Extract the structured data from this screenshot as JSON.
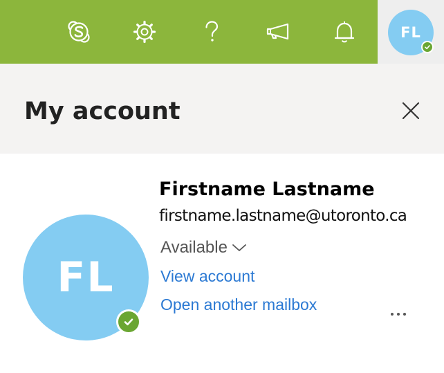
{
  "colors": {
    "topbar_green": "#8cb63c",
    "avatar_blue": "#84ccf2",
    "presence_green": "#6aa632",
    "link_blue": "#2b79d3"
  },
  "topbar": {
    "icons": [
      "skype-icon",
      "gear-icon",
      "help-icon",
      "megaphone-icon",
      "bell-icon"
    ],
    "avatar_initials": "FL"
  },
  "panel": {
    "title": "My account",
    "close_icon": "close-icon"
  },
  "account": {
    "initials": "FL",
    "name": "Firstname Lastname",
    "email": "firstname.lastname@utoronto.ca",
    "status": "Available",
    "view_account": "View account",
    "open_mailbox": "Open another mailbox"
  }
}
